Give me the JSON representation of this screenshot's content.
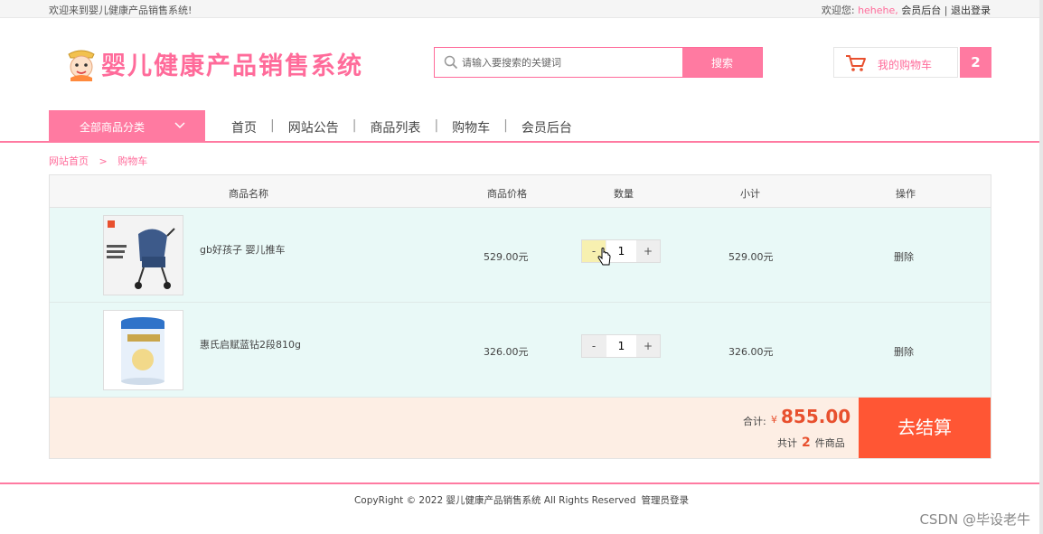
{
  "topbar": {
    "welcome": "欢迎来到婴儿健康产品销售系统!",
    "hello": "欢迎您:",
    "username": "hehehe,",
    "member_center": "会员后台",
    "divider": "|",
    "logout": "退出登录"
  },
  "header": {
    "site_title": "婴儿健康产品销售系统",
    "search_placeholder": "请输入要搜索的关键词",
    "search_button": "搜索",
    "cart_label": "我的购物车",
    "cart_count": "2"
  },
  "nav": {
    "all_categories": "全部商品分类",
    "links": [
      "首页",
      "网站公告",
      "商品列表",
      "购物车",
      "会员后台"
    ],
    "separator": "|"
  },
  "breadcrumb": {
    "home": "网站首页",
    "arrow": ">",
    "current": "购物车"
  },
  "table": {
    "headers": {
      "name": "商品名称",
      "price": "商品价格",
      "quantity": "数量",
      "subtotal": "小计",
      "action": "操作"
    },
    "rows": [
      {
        "name": "gb好孩子 婴儿推车",
        "price": "529.00元",
        "quantity": "1",
        "subtotal": "529.00元",
        "action": "删除",
        "minus": "-",
        "plus": "+"
      },
      {
        "name": "惠氏启赋蓝钻2段810g",
        "price": "326.00元",
        "quantity": "1",
        "subtotal": "326.00元",
        "action": "删除",
        "minus": "-",
        "plus": "+"
      }
    ],
    "footer": {
      "total_label": "合计:",
      "currency": "¥",
      "total": "855.00",
      "count_prefix": "共计",
      "count": "2",
      "count_suffix": "件商品",
      "checkout": "去结算"
    }
  },
  "footer": {
    "copyright": "CopyRight © 2022 婴儿健康产品销售系统 All Rights Reserved",
    "admin_login": "管理员登录"
  },
  "watermark": "CSDN @毕设老牛",
  "colors": {
    "accent": "#ff7aa1",
    "price_red": "#e8502e",
    "checkout": "#ff5634",
    "row_bg": "#e9f9f7",
    "footer_bg": "#fdeee4"
  }
}
